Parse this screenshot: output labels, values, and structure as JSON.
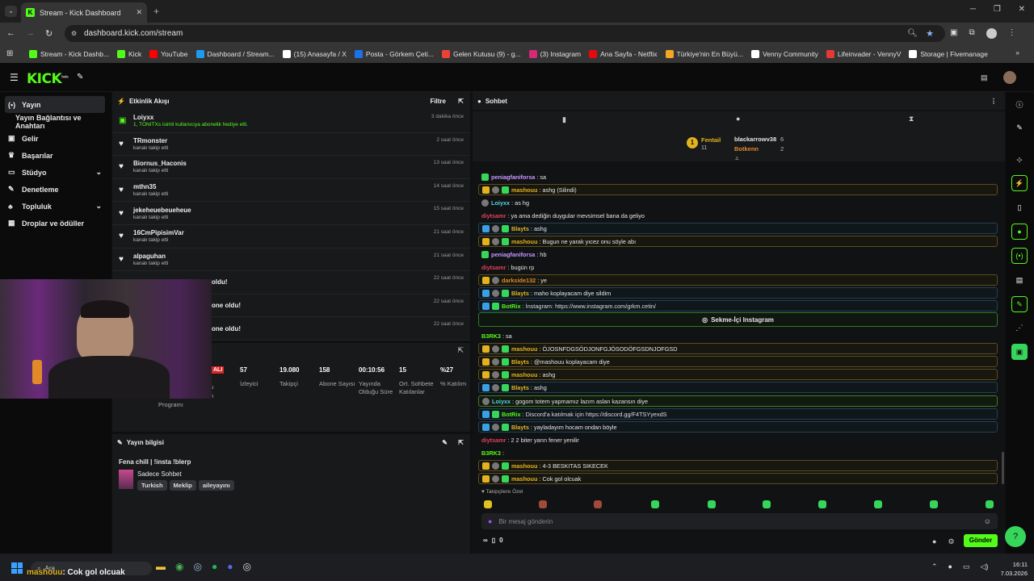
{
  "browser": {
    "tab_title": "Stream - Kick Dashboard",
    "url": "dashboard.kick.com/stream",
    "bookmarks": [
      "Stream - Kick Dashb...",
      "Kick",
      "YouTube",
      "Dashboard / Stream...",
      "(15) Anasayfa / X",
      "Posta - Görkem Çeti...",
      "Gelen Kutusu (9) - g...",
      "(3) Instagram",
      "Ana Sayfa - Netflix",
      "Türkiye'nin En Büyü...",
      "Venny Community",
      "Lifeinvader - VennyV",
      "Storage | Fivemanage"
    ],
    "bookmark_colors": [
      "#53fc18",
      "#53fc18",
      "#ff0000",
      "#1d9bf0",
      "#ffffff",
      "#1a73e8",
      "#ea4335",
      "#d62976",
      "#e50914",
      "#f5a623",
      "#ffffff",
      "#e53935",
      "#ffffff"
    ]
  },
  "app": {
    "logo": "KICK",
    "logo_sup": "beta",
    "accent": "#53fc18"
  },
  "sidebar": {
    "items": [
      {
        "label": "Yayın",
        "icon": "live-icon"
      },
      {
        "label": "Yayın Bağlantısı ve Anahtarı",
        "icon": ""
      },
      {
        "label": "Gelir",
        "icon": "wallet-icon"
      },
      {
        "label": "Başarılar",
        "icon": "trophy-icon"
      },
      {
        "label": "Stüdyo",
        "icon": "studio-icon"
      },
      {
        "label": "Denetleme",
        "icon": "wrench-icon"
      },
      {
        "label": "Topluluk",
        "icon": "community-icon"
      },
      {
        "label": "Droplar ve ödüller",
        "icon": "gift-icon"
      }
    ]
  },
  "activity": {
    "title": "Etkinlik Akışı",
    "filter": "Filtre",
    "events": [
      {
        "name": "Loiyxx",
        "sub": "1, TONITXs isimli kullanıcıya abonelik hediye etti.",
        "time": "3 dakika önce",
        "type": "gift"
      },
      {
        "name": "TRmonster",
        "sub": "kanalı takip etti",
        "time": "2 saat önce",
        "type": "follow"
      },
      {
        "name": "Biornus_Haconis",
        "sub": "kanalı takip etti",
        "time": "13 saat önce",
        "type": "follow"
      },
      {
        "name": "mthn35",
        "sub": "kanalı takip etti",
        "time": "14 saat önce",
        "type": "follow"
      },
      {
        "name": "jekeheuebeueheue",
        "sub": "kanalı takip etti",
        "time": "15 saat önce",
        "type": "follow"
      },
      {
        "name": "16CmPipisimVar",
        "sub": "kanalı takip etti",
        "time": "21 saat önce",
        "type": "follow"
      },
      {
        "name": "alpaguhan",
        "sub": "kanalı takip etti",
        "time": "21 saat önce",
        "type": "follow"
      },
      {
        "name": "oldu!",
        "sub": "",
        "time": "22 saat önce",
        "type": "hidden"
      },
      {
        "name": "one oldu!",
        "sub": "",
        "time": "22 saat önce",
        "type": "hidden"
      },
      {
        "name": "one oldu!",
        "sub": "",
        "time": "22 saat önce",
        "type": "hidden"
      }
    ]
  },
  "stats": {
    "live_badge": "ALI",
    "items": [
      {
        "value": "57",
        "label": "İzleyici"
      },
      {
        "value": "19.080",
        "label": "Takipçi"
      },
      {
        "value": "158",
        "label": "Abone Sayısı"
      },
      {
        "value": "00:10:56",
        "label": "Yayında Olduğu Süre"
      },
      {
        "value": "15",
        "label": "Ort. Sohbete Katılanlar"
      },
      {
        "value": "%27",
        "label": "% Katılım"
      }
    ],
    "partial": [
      "u",
      "n",
      "Programı"
    ]
  },
  "stream_info": {
    "title": "Yayın bilgisi",
    "stream_title": "Fena chill | !insta !blerp",
    "category": "Sadece Sohbet",
    "tags": [
      "Turkish",
      "Meklip",
      "aileyayını"
    ]
  },
  "chat": {
    "title": "Sohbet",
    "leaderboard": {
      "rank1": "1",
      "rank1_name": "Fentail",
      "rank1_count": "11",
      "p1": "blackarrowv38",
      "p1_count": "6",
      "p2": "Botkenn",
      "p2_count": "2"
    },
    "messages": [
      {
        "user": "peniagfaniforsa",
        "text": ": sa",
        "style": "plain-badge",
        "color": "#c896ff",
        "badges": [
          "grn"
        ]
      },
      {
        "user": "mashouu",
        "text": ": ashg (Silindi)",
        "style": "gold",
        "color": "#e3b31f",
        "badges": [
          "gold",
          "gry",
          "grn"
        ]
      },
      {
        "user": "Loiyxx",
        "text": ": as hg",
        "style": "plain",
        "color": "#5bd1e6",
        "badges": [
          "gry"
        ]
      },
      {
        "user": "diytsamr",
        "text": ": ya ama dediğin duygular mevsimsel bana da geliyo",
        "style": "plain",
        "color": "#e0405a",
        "badges": []
      },
      {
        "user": "Blayts",
        "text": ": ashg",
        "style": "blue",
        "color": "#e3b31f",
        "badges": [
          "blue",
          "gry",
          "grn"
        ]
      },
      {
        "user": "mashouu",
        "text": ": Bugun ne yarak yıcez onu söyle abı",
        "style": "gold",
        "color": "#e3b31f",
        "badges": [
          "gold",
          "gry",
          "grn"
        ]
      },
      {
        "user": "peniagfaniforsa",
        "text": ": hb",
        "style": "plain-badge",
        "color": "#c896ff",
        "badges": [
          "grn"
        ]
      },
      {
        "user": "diytsamr",
        "text": ": bugün rp",
        "style": "plain",
        "color": "#e0405a",
        "badges": []
      },
      {
        "user": "darkside132",
        "text": ": ye",
        "style": "gold",
        "color": "#e08a2a",
        "badges": [
          "gold",
          "gry"
        ]
      },
      {
        "user": "Blayts",
        "text": ": maho koplayacam diye sildim",
        "style": "blue",
        "color": "#e3b31f",
        "badges": [
          "blue",
          "gry",
          "grn"
        ]
      },
      {
        "user": "BotRix",
        "text": ": İnstagram: https://www.instagram.com/grkm.cetin/",
        "style": "blue",
        "color": "#53fc18",
        "badges": [
          "blue",
          "grn"
        ]
      },
      {
        "user": "B3RK3",
        "text": ": sa",
        "style": "plain",
        "color": "#53fc18",
        "badges": []
      },
      {
        "user": "mashouu",
        "text": ": ÖJOSNFDGSÖDJONFGJÖSODÖFGSDNJOFGSD",
        "style": "gold",
        "color": "#e3b31f",
        "badges": [
          "gold",
          "gry",
          "grn"
        ]
      },
      {
        "user": "Blayts",
        "text": ": @mashouu koplayacam diye",
        "style": "gold",
        "color": "#e3b31f",
        "badges": [
          "gold",
          "gry",
          "grn"
        ]
      },
      {
        "user": "mashouu",
        "text": ": ashg",
        "style": "gold",
        "color": "#e3b31f",
        "badges": [
          "gold",
          "gry",
          "grn"
        ]
      },
      {
        "user": "Blayts",
        "text": ": ashg",
        "style": "blue",
        "color": "#e3b31f",
        "badges": [
          "blue",
          "gry",
          "grn"
        ]
      },
      {
        "user": "Loiyxx",
        "text": ": gogom totem yapmamız lazım aslan kazansın diye",
        "style": "green",
        "color": "#5bd1e6",
        "badges": [
          "gry"
        ]
      },
      {
        "user": "BotRix",
        "text": ": Discord'a katılmak için https://discord.gg/F4TSYyexdS",
        "style": "blue",
        "color": "#53fc18",
        "badges": [
          "blue",
          "grn"
        ]
      },
      {
        "user": "Blayts",
        "text": ": yayladayım hocam ondan böyle",
        "style": "blue",
        "color": "#e3b31f",
        "badges": [
          "blue",
          "gry",
          "grn"
        ]
      },
      {
        "user": "diytsamr",
        "text": ": 2 2 biter yarın fener yenilir",
        "style": "plain",
        "color": "#e0405a",
        "badges": []
      },
      {
        "user": "B3RK3",
        "text": ":",
        "style": "plain",
        "color": "#53fc18",
        "badges": []
      },
      {
        "user": "mashouu",
        "text": ": 4-3 BESKITAS SIKECEK",
        "style": "gold",
        "color": "#e3b31f",
        "badges": [
          "gold",
          "gry",
          "grn"
        ]
      },
      {
        "user": "mashouu",
        "text": ": Cok gol olcuak",
        "style": "gold",
        "color": "#e3b31f",
        "badges": [
          "gold",
          "gry",
          "grn"
        ]
      }
    ],
    "insta_button": "Sekme-İçi Instagram",
    "followers_special": "Takipçilere Özel",
    "input_placeholder": "Bir mesaj gönderin",
    "points": "0",
    "send": "Gönder"
  },
  "taskbar": {
    "overlay_user": "mashouu",
    "overlay_text": ": Cok gol olcuak",
    "search": "Ara",
    "time": "16:11",
    "date": "7.03.2026"
  }
}
